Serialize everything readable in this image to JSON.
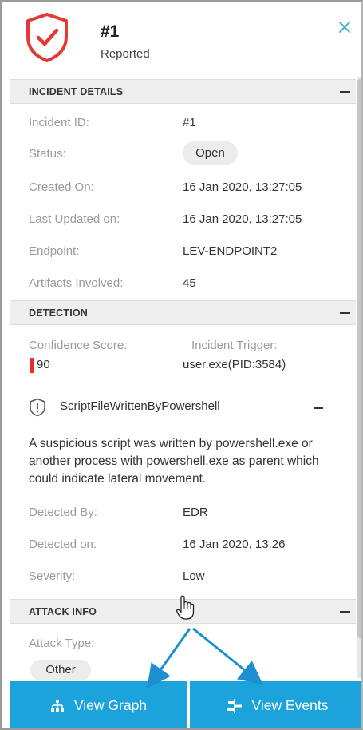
{
  "header": {
    "incident_number": "#1",
    "state": "Reported",
    "shield_color": "#e53935"
  },
  "incident_details": {
    "title": "INCIDENT DETAILS",
    "rows": [
      {
        "label": "Incident ID:",
        "value": "#1"
      },
      {
        "label": "Status:",
        "value": "Open"
      },
      {
        "label": "Created On:",
        "value": "16 Jan 2020, 13:27:05"
      },
      {
        "label": "Last Updated on:",
        "value": "16 Jan 2020, 13:27:05"
      },
      {
        "label": "Endpoint:",
        "value": "LEV-ENDPOINT2"
      },
      {
        "label": "Artifacts Involved:",
        "value": "45"
      }
    ]
  },
  "detection": {
    "title": "DETECTION",
    "confidence_label": "Confidence Score:",
    "confidence_value": "90",
    "trigger_label": "Incident Trigger:",
    "trigger_value": "user.exe(PID:3584)",
    "rule_name": "ScriptFileWrittenByPowershell",
    "description": "A suspicious script was written by powershell.exe or another process with powershell.exe as parent which could indicate lateral movement.",
    "rows": [
      {
        "label": "Detected By:",
        "value": "EDR"
      },
      {
        "label": "Detected on:",
        "value": "16 Jan 2020, 13:26"
      },
      {
        "label": "Severity:",
        "value": "Low"
      }
    ]
  },
  "attack_info": {
    "title": "ATTACK INFO",
    "type_label": "Attack Type:",
    "type_value": "Other"
  },
  "buttons": {
    "view_graph": "View Graph",
    "view_events": "View Events",
    "color": "#1da3dc"
  },
  "icons": {
    "close": "close-icon",
    "shield": "shield-check-icon",
    "rule": "shield-alert-icon",
    "graph": "hierarchy-icon",
    "events": "timeline-icon",
    "cursor": "hand-pointer-icon"
  }
}
